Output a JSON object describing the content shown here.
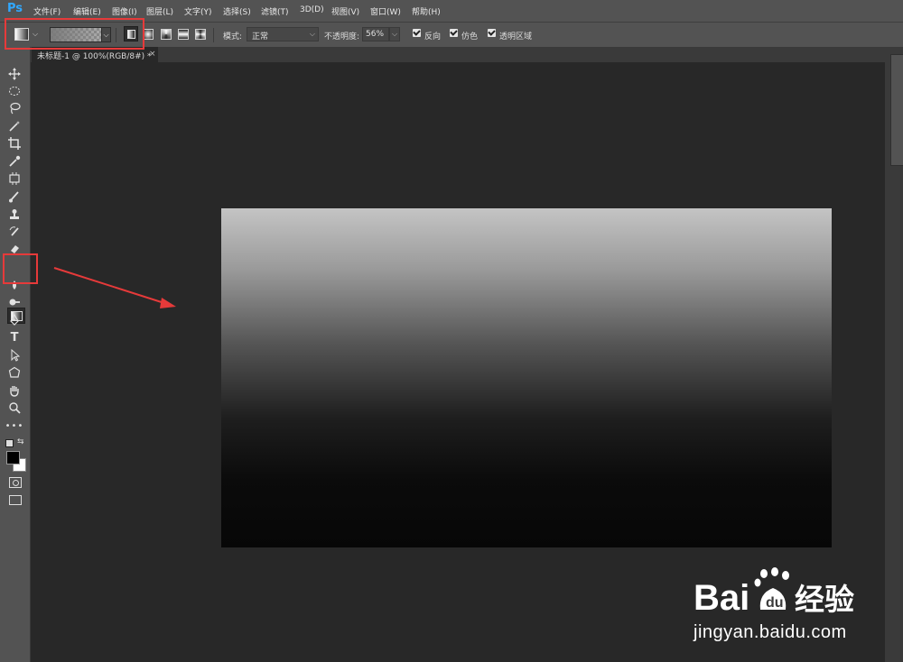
{
  "app": {
    "logo": "Ps"
  },
  "menu": [
    "文件(F)",
    "编辑(E)",
    "图像(I)",
    "图层(L)",
    "文字(Y)",
    "选择(S)",
    "滤镜(T)",
    "3D(D)",
    "视图(V)",
    "窗口(W)",
    "帮助(H)"
  ],
  "options": {
    "mode_label": "模式:",
    "mode_value": "正常",
    "opacity_label": "不透明度:",
    "opacity_value": "56%",
    "reverse_label": "反向",
    "dither_label": "仿色",
    "transparency_label": "透明区域",
    "reverse_checked": true,
    "dither_checked": true,
    "transparency_checked": true
  },
  "document": {
    "tab_label": "未标题-1 @ 100%(RGB/8#) *",
    "close_glyph": "×"
  },
  "canvas": {
    "gradient_stops": [
      "#c4c4c4",
      "#9a9a9a",
      "#555555",
      "#1e1e1e",
      "#0b0b0b",
      "#070707"
    ]
  },
  "annotation_color": "#e63a3a",
  "watermark": {
    "brand": "Bai",
    "brand_suffix": "经验",
    "url": "jingyan.baidu.com"
  },
  "colors": {
    "menubar": "#535353",
    "workspace": "#282828",
    "ps_blue": "#31a8ff"
  }
}
